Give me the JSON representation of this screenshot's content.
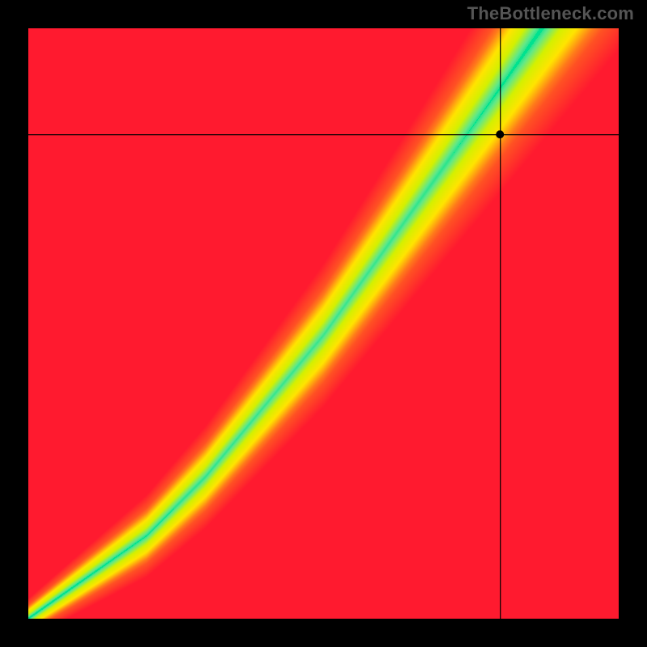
{
  "watermark": "TheBottleneck.com",
  "chart_data": {
    "type": "heatmap",
    "title": "",
    "xlabel": "",
    "ylabel": "",
    "xlim": [
      0,
      1
    ],
    "ylim": [
      0,
      1
    ],
    "marker_point": {
      "x": 0.8,
      "y": 0.82
    },
    "crosshair": {
      "x": 0.8,
      "y": 0.82
    },
    "optimal_curve_description": "Green optimal band follows a monotonically increasing curve from the bottom-left corner (0,0) to roughly (0.85, 1.0); surrounded by yellow transition and red at the extremes.",
    "optimal_curve_samples": [
      {
        "x": 0.0,
        "y": 0.0
      },
      {
        "x": 0.1,
        "y": 0.07
      },
      {
        "x": 0.2,
        "y": 0.14
      },
      {
        "x": 0.3,
        "y": 0.24
      },
      {
        "x": 0.4,
        "y": 0.36
      },
      {
        "x": 0.5,
        "y": 0.48
      },
      {
        "x": 0.6,
        "y": 0.62
      },
      {
        "x": 0.7,
        "y": 0.76
      },
      {
        "x": 0.8,
        "y": 0.9
      },
      {
        "x": 0.87,
        "y": 1.0
      }
    ],
    "color_scale": {
      "0.00": "#ff1a2f",
      "0.35": "#ff7a1a",
      "0.60": "#ffe400",
      "0.82": "#d4f000",
      "0.93": "#5fe88a",
      "1.00": "#00e28f"
    }
  }
}
